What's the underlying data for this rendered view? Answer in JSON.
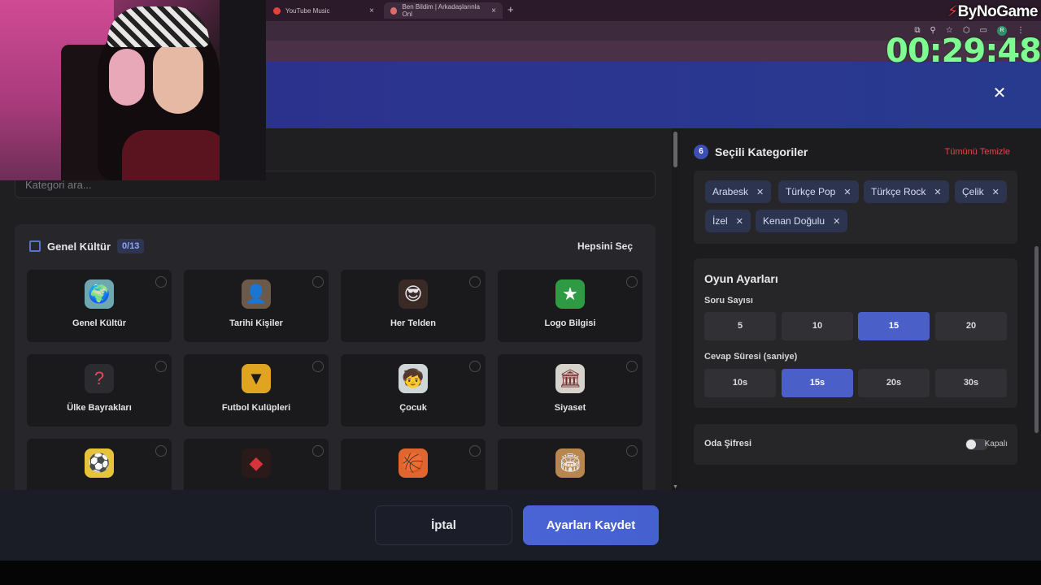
{
  "browser": {
    "tabs": [
      {
        "title": "YouTube Music"
      },
      {
        "title": "Ben Bildim | Arkadaşlarınla Onl"
      }
    ],
    "new_tab": "+",
    "profile_initial": "R"
  },
  "stream": {
    "brand": "ByNoGame",
    "timer": "00:29:48"
  },
  "modal": {
    "close": "✕",
    "search_placeholder": "Kategori ara...",
    "category_group": {
      "title": "Genel Kültür",
      "count": "0/13",
      "select_all": "Hepsini Seç",
      "cards": [
        {
          "label": "Genel Kültür",
          "icon": "globe-icon"
        },
        {
          "label": "Tarihi Kişiler",
          "icon": "portrait-icon"
        },
        {
          "label": "Her Telden",
          "icon": "sunglasses-face-icon"
        },
        {
          "label": "Logo Bilgisi",
          "icon": "logo-badge-icon"
        },
        {
          "label": "Ülke Bayrakları",
          "icon": "flag-question-icon"
        },
        {
          "label": "Futbol Kulüpleri",
          "icon": "wolf-crest-icon"
        },
        {
          "label": "Çocuk",
          "icon": "child-icon"
        },
        {
          "label": "Siyaset",
          "icon": "parliament-icon"
        },
        {
          "label": "",
          "icon": "footballer-icon"
        },
        {
          "label": "",
          "icon": "club-crest-icon"
        },
        {
          "label": "",
          "icon": "sports-balls-icon"
        },
        {
          "label": "",
          "icon": "colosseum-icon"
        }
      ]
    },
    "selected": {
      "count": "6",
      "title": "Seçili Kategoriler",
      "clear_all": "Tümünü Temizle",
      "chips": [
        "Arabesk",
        "Türkçe Pop",
        "Türkçe Rock",
        "Çelik",
        "İzel",
        "Kenan Doğulu"
      ]
    },
    "game_settings": {
      "title": "Oyun Ayarları",
      "question_count_label": "Soru Sayısı",
      "question_counts": [
        "5",
        "10",
        "15",
        "20"
      ],
      "question_count_selected": "15",
      "answer_time_label": "Cevap Süresi (saniye)",
      "answer_times": [
        "10s",
        "15s",
        "20s",
        "30s"
      ],
      "answer_time_selected": "15s"
    },
    "room_password": {
      "label": "Oda Şifresi",
      "state": "Kapalı",
      "enabled": false
    },
    "footer": {
      "cancel": "İptal",
      "save": "Ayarları Kaydet"
    },
    "colors": {
      "accent": "#4a60c8",
      "danger": "#e0484f",
      "timer": "#7dff92"
    }
  }
}
